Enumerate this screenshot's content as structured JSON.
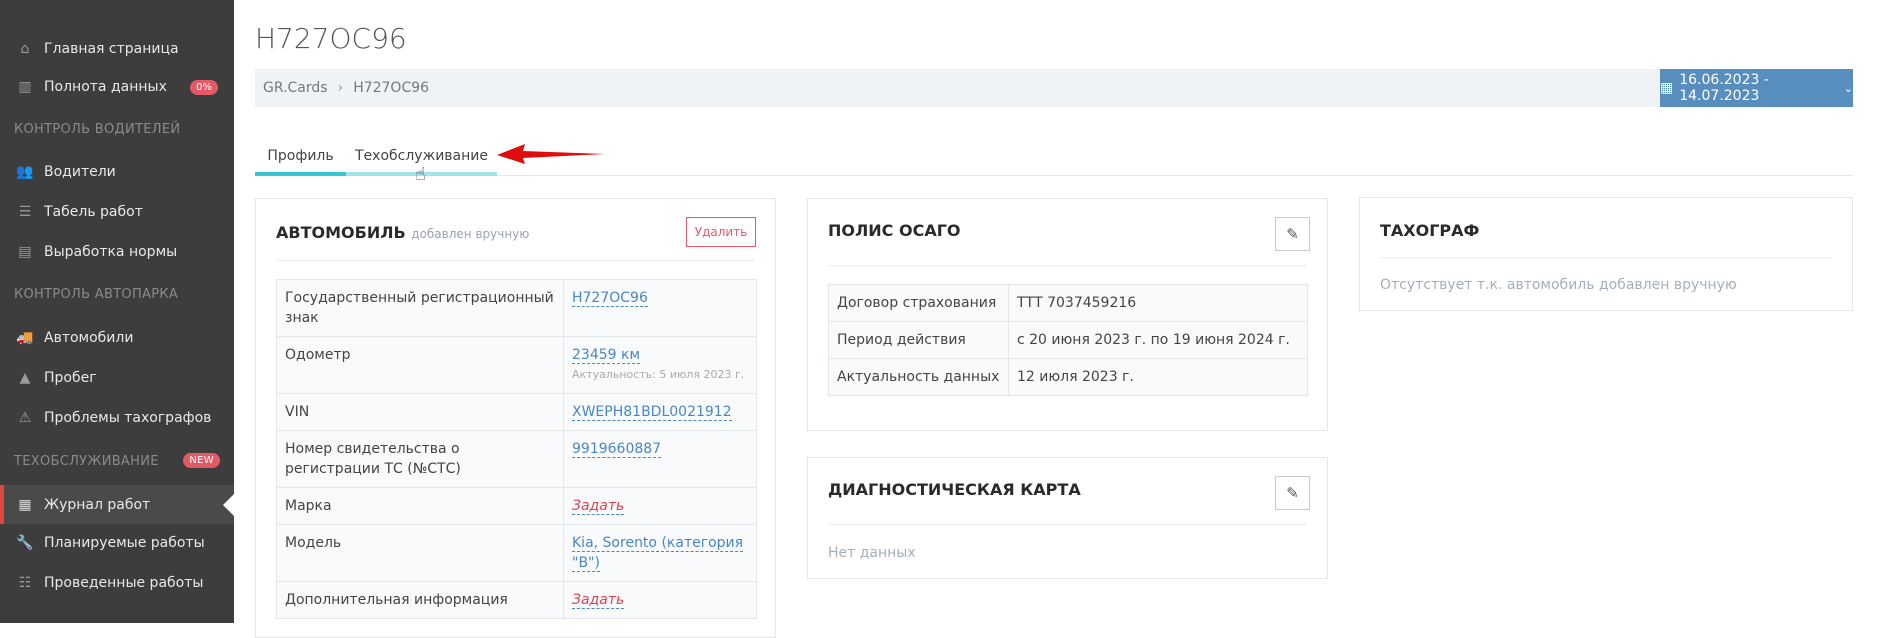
{
  "sidebar": {
    "items": [
      {
        "label": "Главная страница",
        "icon": "home-icon",
        "glyph": "⌂"
      },
      {
        "label": "Полнота данных",
        "icon": "bar-chart-icon",
        "glyph": "▥",
        "badge": "0%"
      },
      {
        "label": "Водители",
        "icon": "users-icon",
        "glyph": "👥"
      },
      {
        "label": "Табель работ",
        "icon": "list-icon",
        "glyph": "☰"
      },
      {
        "label": "Выработка нормы",
        "icon": "tasks-icon",
        "glyph": "▤"
      },
      {
        "label": "Автомобили",
        "icon": "truck-icon",
        "glyph": "🚚"
      },
      {
        "label": "Пробег",
        "icon": "road-icon",
        "glyph": "▲"
      },
      {
        "label": "Проблемы тахографов",
        "icon": "warning-icon",
        "glyph": "⚠"
      },
      {
        "label": "Журнал работ",
        "icon": "calendar-icon",
        "glyph": "▦"
      },
      {
        "label": "Планируемые работы",
        "icon": "wrench-icon",
        "glyph": "🔧"
      },
      {
        "label": "Проведенные работы",
        "icon": "list-alt-icon",
        "glyph": "☷"
      }
    ],
    "sections": [
      "КОНТРОЛЬ ВОДИТЕЛЕЙ",
      "КОНТРОЛЬ АВТОПАРКА",
      "ТЕХОБСЛУЖИВАНИЕ"
    ],
    "new_badge": "NEW"
  },
  "page": {
    "title": "Н727ОС96"
  },
  "breadcrumb": {
    "root": "GR.Cards",
    "current": "Н727ОС96"
  },
  "date_range": {
    "value": "16.06.2023 -  14.07.2023"
  },
  "tabs": [
    {
      "label": "Профиль",
      "active": true
    },
    {
      "label": "Техобслуживание",
      "active": false
    }
  ],
  "car": {
    "title": "АВТОМОБИЛЬ",
    "subtitle": "добавлен вручную",
    "delete_label": "Удалить",
    "rows": [
      {
        "label": "Государственный регистрационный знак",
        "value": "Н727ОС96"
      },
      {
        "label": "Одометр",
        "value": "23459 км",
        "note": "Актуальность: 5 июля 2023 г."
      },
      {
        "label": "VIN",
        "value": "XWEPH81BDL0021912"
      },
      {
        "label": "Номер свидетельства о регистрации ТС (№СТС)",
        "value": "9919660887"
      },
      {
        "label": "Марка",
        "value": "Задать"
      },
      {
        "label": "Модель",
        "value": "Kia, Sorento (категория \"B\")"
      },
      {
        "label": "Дополнительная информация",
        "value": "Задать"
      }
    ]
  },
  "osago": {
    "title": "ПОЛИС ОСАГО",
    "rows": [
      {
        "label": "Договор страхования",
        "value": "ТТТ 7037459216"
      },
      {
        "label": "Период действия",
        "value": "с 20 июня 2023 г. по 19 июня 2024 г."
      },
      {
        "label": "Актуальность данных",
        "value": "12 июля 2023 г."
      }
    ]
  },
  "diag": {
    "title": "ДИАГНОСТИЧЕСКАЯ КАРТА",
    "empty": "Нет данных"
  },
  "tacho": {
    "title": "ТАХОГРАФ",
    "empty": "Отсутствует т.к. автомобиль добавлен вручную"
  },
  "colors": {
    "sidebar": "#3d3d3d",
    "accent": "#37c5d1",
    "date_button": "#578ebe",
    "danger": "#e35a66",
    "link": "#4a86c5"
  }
}
